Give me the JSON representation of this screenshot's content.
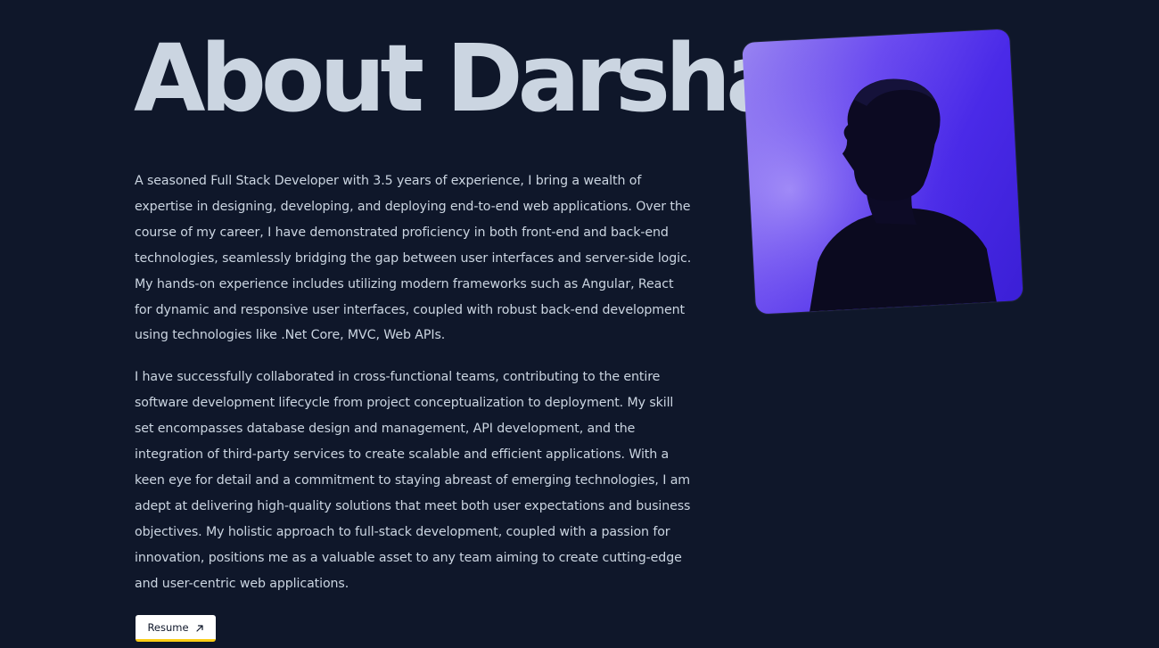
{
  "about": {
    "title": "About Darshan",
    "paragraphs": [
      "A seasoned Full Stack Developer with 3.5 years of experience, I bring a wealth of expertise in designing, developing, and deploying end-to-end web applications. Over the course of my career, I have demonstrated proficiency in both front-end and back-end technologies, seamlessly bridging the gap between user interfaces and server-side logic. My hands-on experience includes utilizing modern frameworks such as Angular, React for dynamic and responsive user interfaces, coupled with robust back-end development using technologies like .Net Core, MVC, Web APIs.",
      "I have successfully collaborated in cross-functional teams, contributing to the entire software development lifecycle from project conceptualization to deployment. My skill set encompasses database design and management, API development, and the integration of third-party services to create scalable and efficient applications. With a keen eye for detail and a commitment to staying abreast of emerging technologies, I am adept at delivering high-quality solutions that meet both user expectations and business objectives. My holistic approach to full-stack development, coupled with a passion for innovation, positions me as a valuable asset to any team aiming to create cutting-edge and user-centric web applications."
    ],
    "resume_button": {
      "label": "Resume",
      "icon": "arrow-up-right-icon"
    },
    "portrait": {
      "icon": "portrait-silhouette"
    }
  },
  "colors": {
    "background": "#0f172a",
    "text": "#cbd5e1",
    "button_bg": "#ffffff",
    "button_accent": "#facc15",
    "portrait_accent": "#4a2ae8"
  }
}
